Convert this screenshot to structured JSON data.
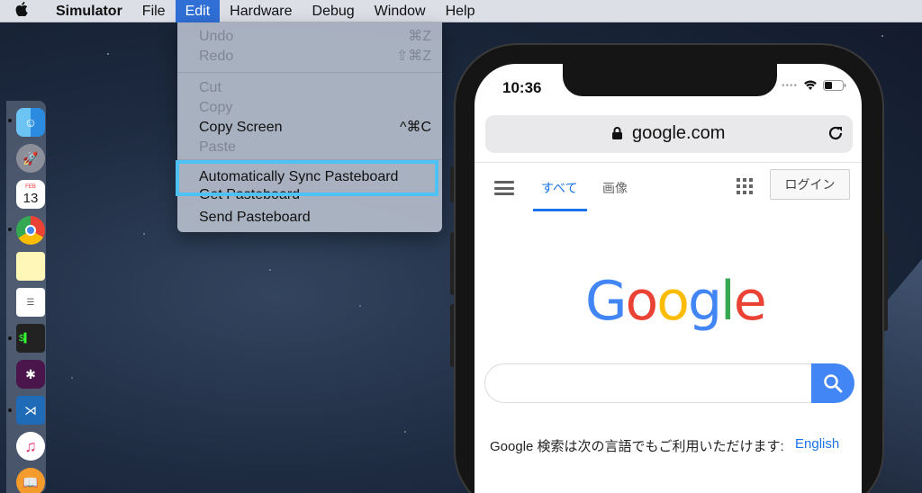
{
  "menubar": {
    "app": "Simulator",
    "items": [
      "File",
      "Edit",
      "Hardware",
      "Debug",
      "Window",
      "Help"
    ],
    "active": "Edit"
  },
  "edit_menu": {
    "items": [
      {
        "label": "Undo",
        "shortcut": "⌘Z",
        "enabled": false
      },
      {
        "label": "Redo",
        "shortcut": "⇧⌘Z",
        "enabled": false
      },
      {
        "label": "Cut",
        "shortcut": "",
        "enabled": false
      },
      {
        "label": "Copy",
        "shortcut": "",
        "enabled": false
      },
      {
        "label": "Copy Screen",
        "shortcut": "^⌘C",
        "enabled": true
      },
      {
        "label": "Paste",
        "shortcut": "",
        "enabled": false
      },
      {
        "label": "Automatically Sync Pasteboard",
        "shortcut": "",
        "enabled": true
      },
      {
        "label": "Get Pasteboard",
        "shortcut": "",
        "enabled": true
      },
      {
        "label": "Send Pasteboard",
        "shortcut": "",
        "enabled": true
      }
    ]
  },
  "dock": {
    "apps": [
      "finder-icon",
      "launchpad-icon",
      "calendar-icon",
      "chrome-icon",
      "notes-icon",
      "reminders-icon",
      "terminal-icon",
      "slack-icon",
      "vscode-icon",
      "itunes-icon",
      "books-icon"
    ],
    "calendar": {
      "month": "FEB",
      "day": "13"
    }
  },
  "phone": {
    "time": "10:36",
    "address": "google.com",
    "tabs": {
      "all": "すべて",
      "images": "画像"
    },
    "login": "ログイン",
    "logo": "Google",
    "footer_text": "Google 検索は次の言語でもご利用いただけます:",
    "footer_link": "English"
  },
  "colors": {
    "menu_active": "#2f6fd6",
    "highlight": "#4ec2f7",
    "google_blue": "#4285f4",
    "google_red": "#ea4335",
    "google_yellow": "#fbbc05",
    "google_green": "#34a853"
  }
}
